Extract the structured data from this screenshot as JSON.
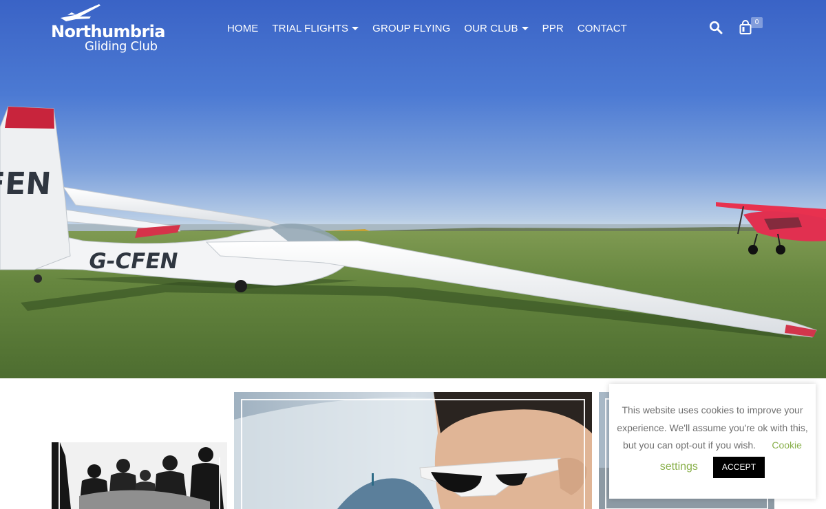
{
  "brand": {
    "name_line1": "Northumbria",
    "name_line2": "Gliding Club"
  },
  "nav": {
    "items": [
      {
        "label": "HOME"
      },
      {
        "label": "TRIAL FLIGHTS"
      },
      {
        "label": "GROUP FLYING"
      },
      {
        "label": "OUR CLUB"
      },
      {
        "label": "PPR"
      },
      {
        "label": "CONTACT"
      }
    ]
  },
  "header_actions": {
    "search_icon": "search-icon",
    "cart_icon": "shopping-bag-icon",
    "cart_count": "0"
  },
  "hero": {
    "glider_registration_fuselage": "G-CFEN",
    "glider_registration_tail": "FEN",
    "sky_color": "#3a63c6",
    "grass_color": "#5f7f3c"
  },
  "cookie_banner": {
    "text": "This website uses cookies to improve your experience. We'll assume you're ok with this, but you can opt-out if you wish.",
    "settings_link": "Cookie settings",
    "accept_label": "ACCEPT",
    "link_color": "#89b04b"
  }
}
